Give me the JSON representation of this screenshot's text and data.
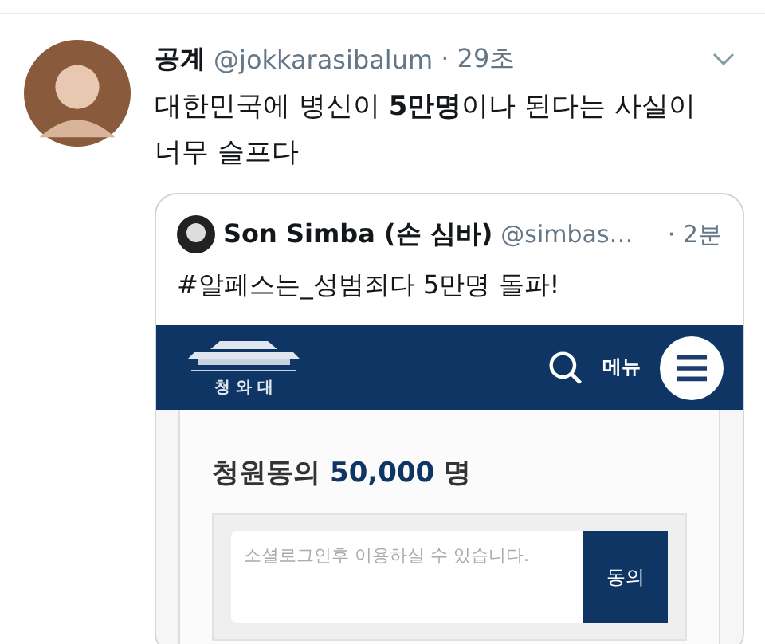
{
  "tweet": {
    "display_name": "공계",
    "handle": "@jokkarasibalum",
    "time": "· 29초",
    "text": "대한민국에 병신이 **5만명**이나 된다는 사실이 너무 슬프다"
  },
  "quote": {
    "display_name": "Son Simba (손 심바)",
    "handle": "@simbas…",
    "time": "· 2분",
    "text": "#알페스는_성범죄다 5만명 돌파!",
    "screenshot": {
      "logo_text": "청 와 대",
      "menu_label": "메뉴",
      "petition_label": "청원동의",
      "count": "50,000",
      "unit": "명",
      "placeholder": "소셜로그인후 이용하실 수 있습니다.",
      "agree_button": "동의"
    }
  }
}
